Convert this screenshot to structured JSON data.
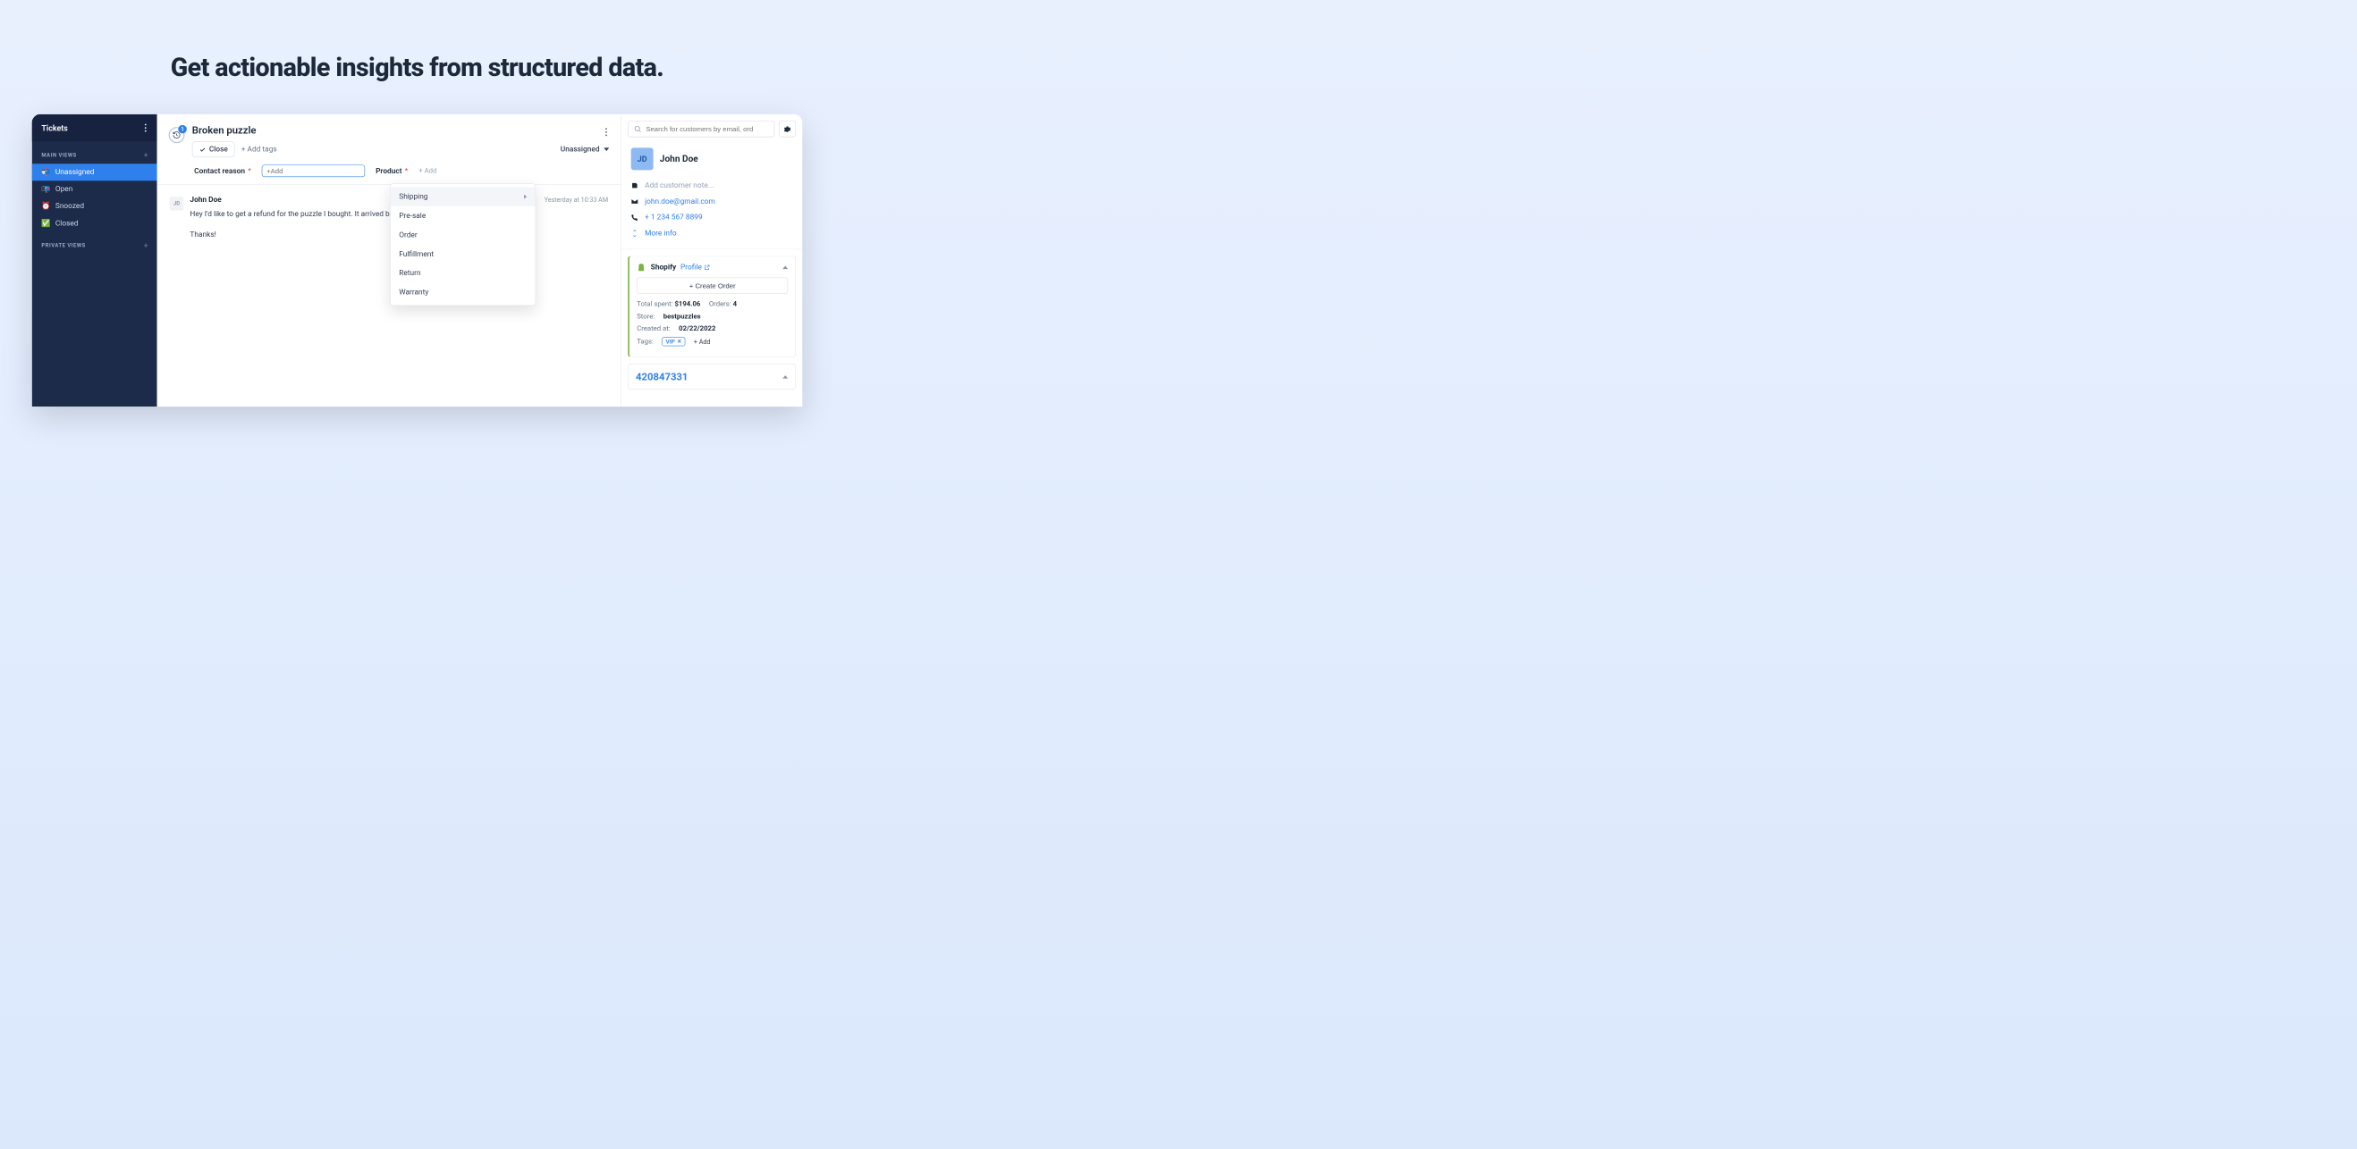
{
  "hero": "Get actionable insights from structured data.",
  "sidebar": {
    "title": "Tickets",
    "main_label": "MAIN VIEWS",
    "private_label": "PRIVATE VIEWS",
    "items": [
      {
        "icon": "📬",
        "label": "Unassigned"
      },
      {
        "icon": "📭",
        "label": "Open"
      },
      {
        "icon": "⏰",
        "label": "Snoozed"
      },
      {
        "icon": "✅",
        "label": "Closed"
      }
    ]
  },
  "ticket": {
    "title": "Broken puzzle",
    "badge_count": "1",
    "close": "Close",
    "add_tags": "+ Add tags",
    "assignee": "Unassigned",
    "contact_reason_label": "Contact reason",
    "product_label": "Product",
    "add_placeholder": "+Add",
    "add_ghost": "+ Add"
  },
  "dropdown": [
    "Shipping",
    "Pre-sale",
    "Order",
    "Fulfillment",
    "Return",
    "Warranty"
  ],
  "message": {
    "avatar": "JD",
    "author": "John Doe",
    "time": "Yesterday at 10:33 AM",
    "line1": "Hey I'd like to get a refund for the puzzle I bought. It arrived broken",
    "line2": "Thanks!"
  },
  "right": {
    "search_placeholder": "Search for customers by email, ord",
    "avatar": "JD",
    "name": "John Doe",
    "note_placeholder": "Add customer note...",
    "email": "john.doe@gmail.com",
    "phone": "+ 1 234 567 8899",
    "more": "More info"
  },
  "shopify": {
    "title": "Shopify",
    "profile": "Profile",
    "create": "+  Create Order",
    "total_k": "Total spent:",
    "total_v": "$194.06",
    "orders_k": "Orders:",
    "orders_v": "4",
    "store_k": "Store:",
    "store_v": "bestpuzzles",
    "created_k": "Created at:",
    "created_v": "02/22/2022",
    "tags_k": "Tags:",
    "vip": "VIP",
    "add_tag": "+ Add",
    "order_num": "420847331"
  }
}
